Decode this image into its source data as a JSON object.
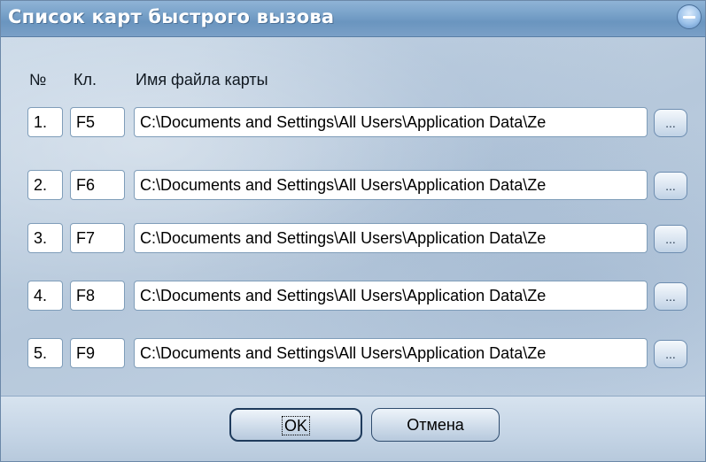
{
  "window": {
    "title": "Список карт быстрого вызова"
  },
  "headers": {
    "num": "№",
    "key": "Кл.",
    "file": "Имя файла карты"
  },
  "rows": [
    {
      "num": "1.",
      "key": "F5",
      "path": "C:\\Documents and Settings\\All Users\\Application Data\\Ze",
      "browse": "..."
    },
    {
      "num": "2.",
      "key": "F6",
      "path": "C:\\Documents and Settings\\All Users\\Application Data\\Ze",
      "browse": "..."
    },
    {
      "num": "3.",
      "key": "F7",
      "path": "C:\\Documents and Settings\\All Users\\Application Data\\Ze",
      "browse": "..."
    },
    {
      "num": "4.",
      "key": "F8",
      "path": "C:\\Documents and Settings\\All Users\\Application Data\\Ze",
      "browse": "..."
    },
    {
      "num": "5.",
      "key": "F9",
      "path": "C:\\Documents and Settings\\All Users\\Application Data\\Ze",
      "browse": "..."
    }
  ],
  "buttons": {
    "ok": "OK",
    "cancel": "Отмена"
  }
}
